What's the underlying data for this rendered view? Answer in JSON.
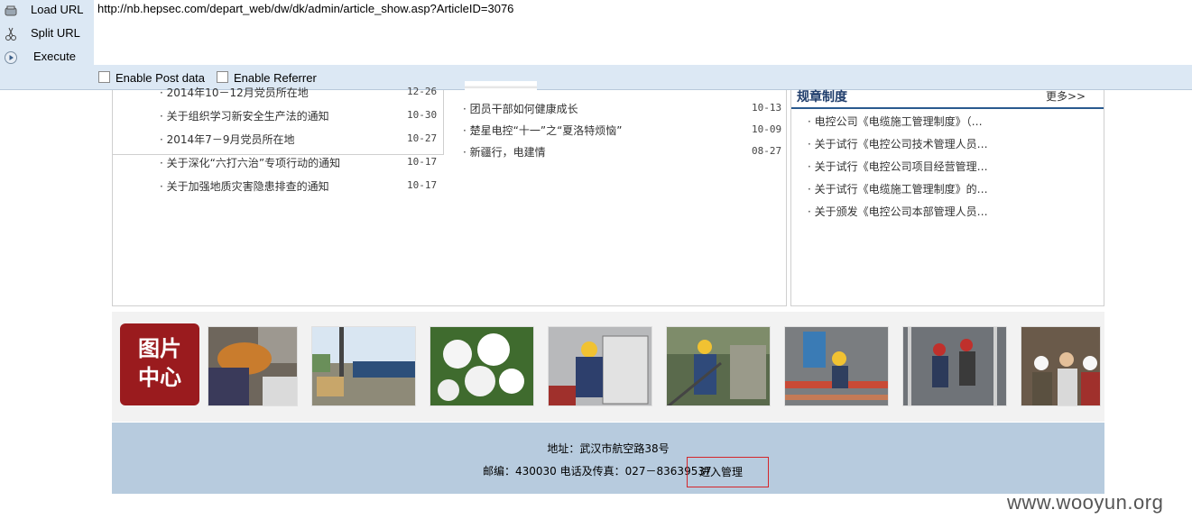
{
  "toolbar": {
    "load_url": "Load URL",
    "split_url": "Split URL",
    "execute": "Execute",
    "url": "http://nb.hepsec.com/depart_web/dw/dk/admin/article_show.asp?ArticleID=3076",
    "enable_post": "Enable Post data",
    "enable_referrer": "Enable Referrer"
  },
  "left_news": [
    {
      "title": "2014年10－12月党员所在地",
      "date": "12-26"
    },
    {
      "title": "关于组织学习新安全生产法的通知",
      "date": "10-30"
    },
    {
      "title": "2014年7－9月党员所在地",
      "date": "10-27"
    },
    {
      "title": "关于深化“六打六治”专项行动的通知",
      "date": "10-17"
    },
    {
      "title": "关于加强地质灾害隐患排查的通知",
      "date": "10-17"
    }
  ],
  "mid_news": [
    {
      "title": "团员干部如何健康成长",
      "date": "10-13"
    },
    {
      "title": "楚星电控“十一”之“夏洛特烦恼”",
      "date": "10-09"
    },
    {
      "title": "新疆行，电建情",
      "date": "08-27"
    }
  ],
  "rules": {
    "title": "规章制度",
    "more": "更多>>",
    "items": [
      "电控公司《电缆施工管理制度》（…",
      "关于试行《电控公司技术管理人员…",
      "关于试行《电控公司项目经营管理…",
      "关于试行《电缆施工管理制度》的…",
      "关于颁发《电控公司本部管理人员…"
    ]
  },
  "gallery": {
    "badge_line1": "图片",
    "badge_line2": "中心"
  },
  "footer": {
    "address": "地址：武汉市航空路38号",
    "contact": "邮编：430030 电话及传真：027－83639537",
    "admin": "进入管理"
  },
  "watermark": "www.wooyun.org"
}
